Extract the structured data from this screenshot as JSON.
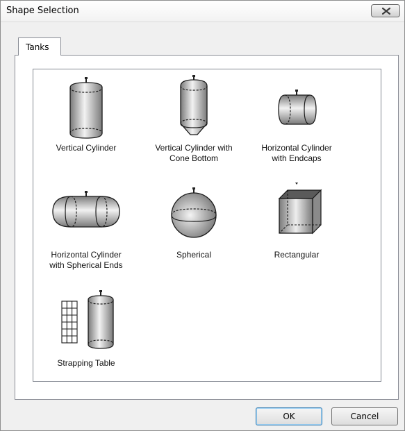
{
  "window": {
    "title": "Shape Selection",
    "close_icon": "close-x-icon"
  },
  "tabs": [
    {
      "label": "Tanks",
      "selected": true
    }
  ],
  "shapes": [
    {
      "label": "Vertical Cylinder",
      "icon": "vertical-cylinder-icon"
    },
    {
      "label": "Vertical Cylinder with\nCone Bottom",
      "icon": "vertical-cylinder-cone-bottom-icon"
    },
    {
      "label": "Horizontal Cylinder\nwith Endcaps",
      "icon": "horizontal-cylinder-endcaps-icon"
    },
    {
      "label": "Horizontal Cylinder\nwith Spherical Ends",
      "icon": "horizontal-cylinder-spherical-ends-icon"
    },
    {
      "label": "Spherical",
      "icon": "sphere-icon"
    },
    {
      "label": "Rectangular",
      "icon": "rectangular-tank-icon"
    },
    {
      "label": "Strapping Table",
      "icon": "strapping-table-icon"
    }
  ],
  "buttons": {
    "ok_label": "OK",
    "cancel_label": "Cancel"
  },
  "colors": {
    "tank_fill_light": "#f2f2f2",
    "tank_fill_dark": "#8a8a8a",
    "outline": "#1a1a1a"
  }
}
